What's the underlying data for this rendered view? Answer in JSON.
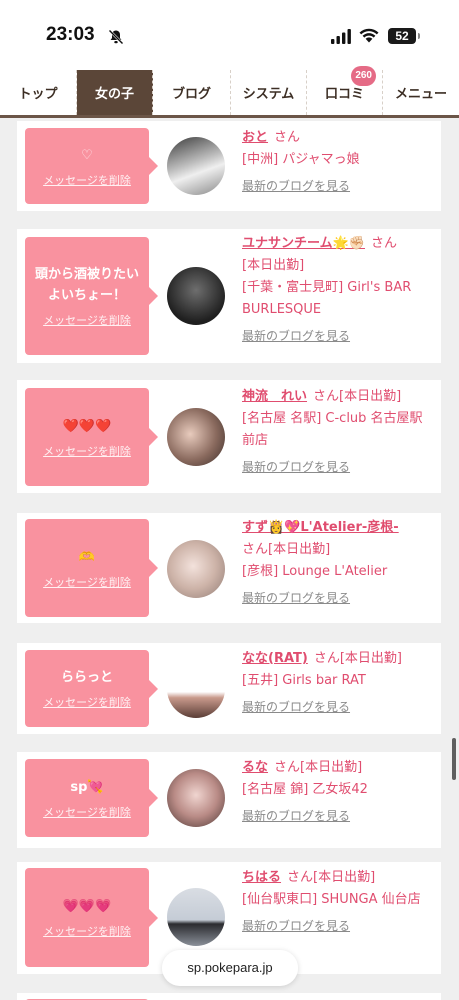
{
  "status": {
    "time": "23:03",
    "battery": "52"
  },
  "nav": {
    "tabs": [
      {
        "label": "トップ",
        "active": false
      },
      {
        "label": "女の子",
        "active": true
      },
      {
        "label": "ブログ",
        "active": false
      },
      {
        "label": "システム",
        "active": false
      },
      {
        "label": "口コミ",
        "active": false,
        "badge": "260"
      },
      {
        "label": "メニュー",
        "active": false
      }
    ]
  },
  "cards": [
    {
      "message": "♡",
      "delete_label": "メッセージを削除",
      "name": "おと",
      "san": "さん",
      "status": "",
      "shop": "[中洲] パジャマっ娘",
      "blog_link": "最新のブログを見る"
    },
    {
      "message": "頭から酒被りたいよいちょー！",
      "delete_label": "メッセージを削除",
      "name": "ユナサンチーム🌟✊🏻",
      "san": "さん",
      "status": "[本日出勤]",
      "shop": "[千葉・富士見町] Girl's BAR BURLESQUE",
      "blog_link": "最新のブログを見る"
    },
    {
      "message": "❤️❤️❤️",
      "delete_label": "メッセージを削除",
      "name": "神流　れい",
      "san": "さん",
      "status": "[本日出勤]",
      "shop": "[名古屋 名駅] C-club 名古屋駅前店",
      "blog_link": "最新のブログを見る"
    },
    {
      "message": "🫶",
      "delete_label": "メッセージを削除",
      "name": "すず👸💖L'Atelier-彦根-",
      "san": "さん",
      "status": "[本日出勤]",
      "shop": "[彦根] Lounge L'Atelier",
      "blog_link": "最新のブログを見る"
    },
    {
      "message": "ららっと",
      "delete_label": "メッセージを削除",
      "name": "なな(RAT)",
      "san": "さん",
      "status": "[本日出勤]",
      "shop": "[五井] Girls bar RAT",
      "blog_link": "最新のブログを見る"
    },
    {
      "message": "sp💘",
      "delete_label": "メッセージを削除",
      "name": "るな",
      "san": "さん",
      "status": "[本日出勤]",
      "shop": "[名古屋 錦] 乙女坂42",
      "blog_link": "最新のブログを見る"
    },
    {
      "message": "💗💗💗",
      "delete_label": "メッセージを削除",
      "name": "ちはる",
      "san": "さん",
      "status": "[本日出勤]",
      "shop": "[仙台駅東口] SHUNGA 仙台店",
      "blog_link": "最新のブログを見る"
    }
  ],
  "url_bar": {
    "domain": "sp.pokepara.jp"
  },
  "colors": {
    "accent": "#e04d6f",
    "bubble": "#f9929f",
    "nav_active": "#5b4638"
  }
}
